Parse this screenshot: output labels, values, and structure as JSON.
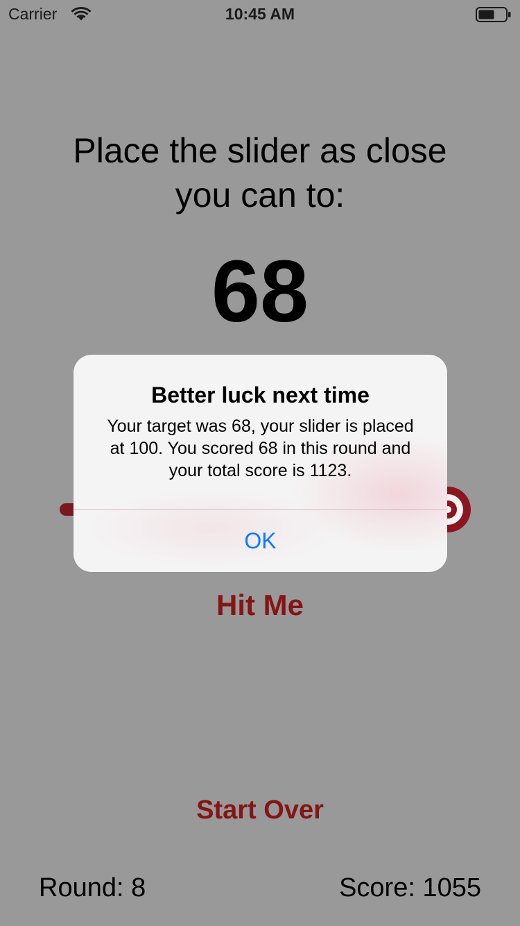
{
  "status_bar": {
    "carrier": "Carrier",
    "time": "10:45 AM",
    "wifi_icon": "wifi-icon",
    "battery_icon": "battery-icon"
  },
  "game": {
    "instruction_line1": "Place the slider as close",
    "instruction_line2": "you can to:",
    "target_value": "68",
    "slider_value_fraction": 1.0,
    "hit_me_label": "Hit Me",
    "start_over_label": "Start Over",
    "round_text": "Round: 8",
    "score_text": "Score: 1055"
  },
  "alert": {
    "title": "Better luck next time",
    "message": "Your target was 68, your slider is placed at 100. You scored 68 in this round and your total score is 1123.",
    "ok_label": "OK"
  },
  "colors": {
    "background": "#999999",
    "accent": "#841515",
    "alert_button": "#0a7aff"
  }
}
